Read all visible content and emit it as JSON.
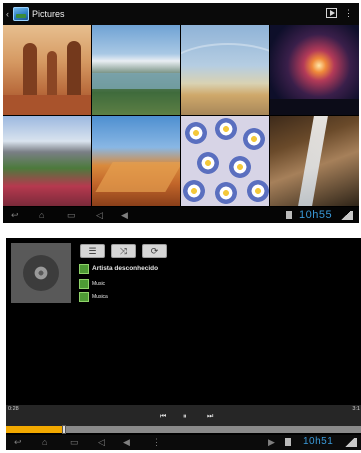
{
  "gallery": {
    "back_icon": "back-arrow-icon",
    "app_icon": "gallery-app-icon",
    "title": "Pictures",
    "slideshow_icon": "slideshow-play-icon",
    "menu_icon": "overflow-menu-icon",
    "thumbnails": [
      "desert-rock-formations",
      "mountain-lake",
      "beach-dunes",
      "fireworks",
      "flower-meadow-mountain",
      "sand-dunes",
      "blue-flowers",
      "waterfall"
    ],
    "status_bar": {
      "nav_icons": [
        "back-icon",
        "home-icon",
        "recent-apps-icon",
        "volume-down-icon",
        "volume-up-icon"
      ],
      "clock": "10h55",
      "status_icons": [
        "lock-icon",
        "wifi-icon",
        "battery-icon"
      ]
    }
  },
  "music": {
    "album_art_icon": "cd-disc-icon",
    "controls": [
      {
        "icon": "list-icon",
        "glyph": "☰"
      },
      {
        "icon": "shuffle-icon",
        "glyph": "⤨"
      },
      {
        "icon": "repeat-icon",
        "glyph": "⟳"
      }
    ],
    "artist": "Artista desconhecido",
    "album": "Music",
    "track": "Musica",
    "elapsed": "0:28",
    "total": "3:1",
    "progress_fraction": 0.16,
    "transport": {
      "prev_glyph": "⏮",
      "play_glyph": "⏸",
      "next_glyph": "⏭"
    },
    "accent_color": "#f2a900",
    "status_bar": {
      "nav_icons": [
        "back-icon",
        "home-icon",
        "recent-apps-icon",
        "volume-down-icon",
        "volume-up-icon",
        "menu-icon"
      ],
      "clock": "10h51",
      "status_icons": [
        "play-indicator-icon",
        "lock-icon",
        "wifi-icon",
        "battery-icon"
      ]
    }
  }
}
